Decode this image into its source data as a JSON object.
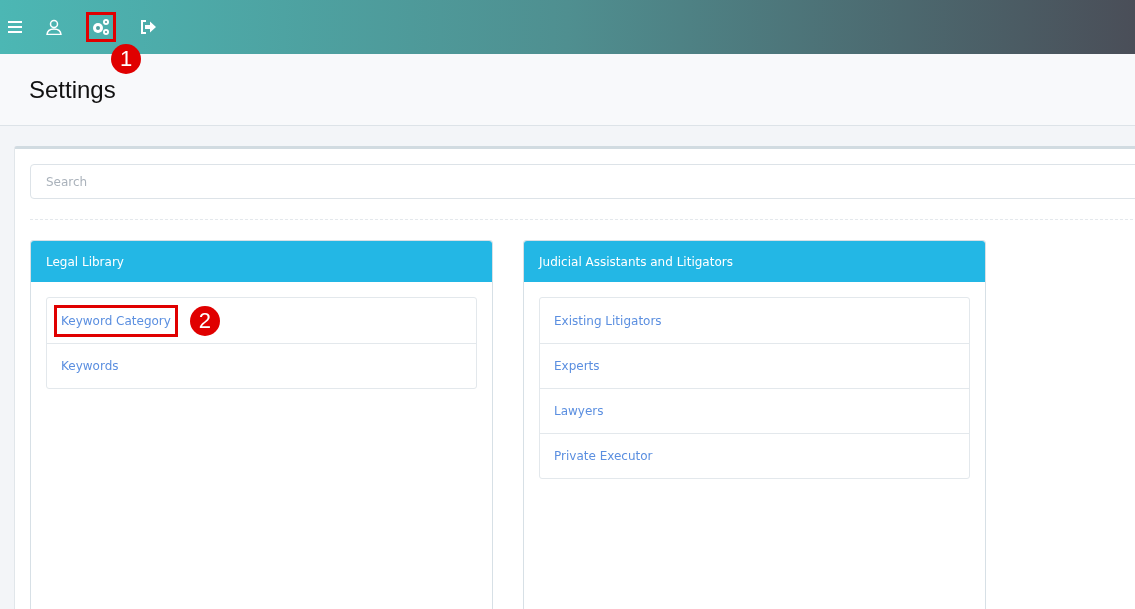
{
  "toolbar": [
    {
      "kind": "menu",
      "highlighted": false
    },
    {
      "kind": "user",
      "highlighted": false
    },
    {
      "kind": "settings",
      "highlighted": true,
      "callout": "1"
    },
    {
      "kind": "logout",
      "highlighted": false
    }
  ],
  "page": {
    "title": "Settings"
  },
  "search": {
    "placeholder": "Search"
  },
  "panels": [
    {
      "title": "Legal Library",
      "items": [
        {
          "label": "Keyword Category",
          "highlighted": true,
          "callout": "2"
        },
        {
          "label": "Keywords",
          "highlighted": false
        }
      ]
    },
    {
      "title": "Judicial Assistants and Litigators",
      "items": [
        {
          "label": "Existing Litigators",
          "highlighted": false
        },
        {
          "label": "Experts",
          "highlighted": false
        },
        {
          "label": "Lawyers",
          "highlighted": false
        },
        {
          "label": "Private Executor",
          "highlighted": false
        }
      ]
    }
  ]
}
